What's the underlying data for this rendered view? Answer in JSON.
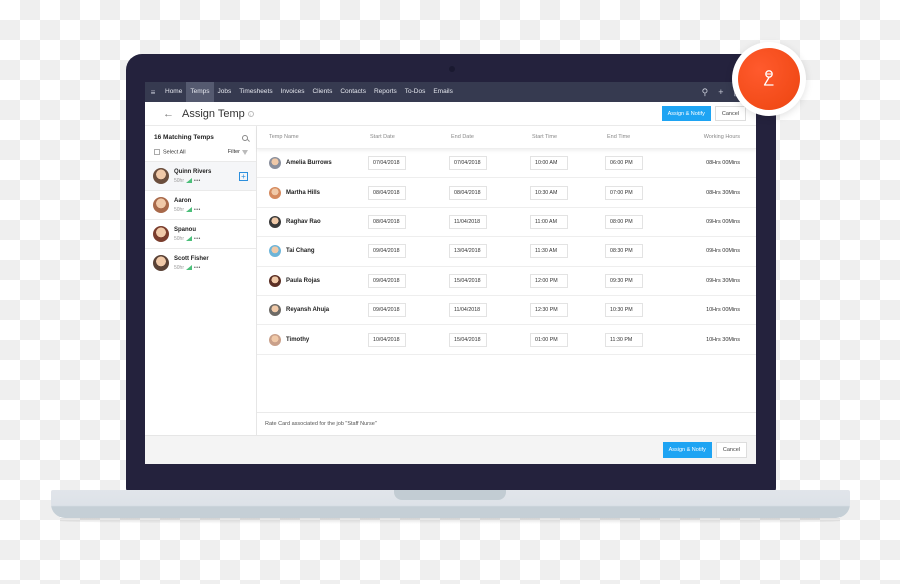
{
  "nav": {
    "items": [
      "Home",
      "Temps",
      "Jobs",
      "Timesheets",
      "Invoices",
      "Clients",
      "Contacts",
      "Reports",
      "To-Dos",
      "Emails"
    ],
    "active": "Temps",
    "icons": [
      "search-icon",
      "plus-icon",
      "calendar-icon"
    ]
  },
  "header": {
    "title": "Assign Temp",
    "assign_label": "Assign & Notify",
    "cancel_label": "Cancel"
  },
  "sidebar": {
    "title": "16 Matching Temps",
    "select_all": "Select All",
    "filter": "Filter",
    "temps": [
      {
        "name": "Quinn Rivers",
        "rate": "50hr",
        "selected": true,
        "avatar_color": "#6b4e3d"
      },
      {
        "name": "Aaron",
        "rate": "50hr",
        "selected": false,
        "avatar_color": "#a8694a"
      },
      {
        "name": "Spanou",
        "rate": "50hr",
        "selected": false,
        "avatar_color": "#7a3d2d"
      },
      {
        "name": "Scott Fisher",
        "rate": "50hr",
        "selected": false,
        "avatar_color": "#5a4236"
      }
    ]
  },
  "table": {
    "headers": {
      "name": "Temp Name",
      "start_date": "Start Date",
      "end_date": "End Date",
      "start_time": "Start Time",
      "end_time": "End Time",
      "working_hours": "Working Hours"
    },
    "rows": [
      {
        "name": "Amelia Burrows",
        "start_date": "07/04/2018",
        "end_date": "07/04/2018",
        "start_time": "10:00 AM",
        "end_time": "06:00 PM",
        "hours": "08Hrs 00Mins",
        "avatar_color": "#8a8f9c"
      },
      {
        "name": "Martha Hills",
        "start_date": "08/04/2018",
        "end_date": "08/04/2018",
        "start_time": "10:30 AM",
        "end_time": "07:00 PM",
        "hours": "08Hrs 30Mins",
        "avatar_color": "#d58a5e"
      },
      {
        "name": "Raghav Rao",
        "start_date": "08/04/2018",
        "end_date": "11/04/2018",
        "start_time": "11:00 AM",
        "end_time": "08:00 PM",
        "hours": "09Hrs 00Mins",
        "avatar_color": "#3a3a3a"
      },
      {
        "name": "Tai Chang",
        "start_date": "09/04/2018",
        "end_date": "13/04/2018",
        "start_time": "11:30 AM",
        "end_time": "08:30 PM",
        "hours": "09Hrs 00Mins",
        "avatar_color": "#6cb4d8"
      },
      {
        "name": "Paula Rojas",
        "start_date": "09/04/2018",
        "end_date": "15/04/2018",
        "start_time": "12:00 PM",
        "end_time": "09:30 PM",
        "hours": "09Hrs 30Mins",
        "avatar_color": "#5b2f24"
      },
      {
        "name": "Reyansh Ahuja",
        "start_date": "09/04/2018",
        "end_date": "11/04/2018",
        "start_time": "12:30 PM",
        "end_time": "10:30 PM",
        "hours": "10Hrs 00Mins",
        "avatar_color": "#6d6a66"
      },
      {
        "name": "Timothy",
        "start_date": "10/04/2018",
        "end_date": "15/04/2018",
        "start_time": "01:00 PM",
        "end_time": "11:30 PM",
        "hours": "10Hrs 30Mins",
        "avatar_color": "#c9a08a"
      }
    ],
    "rate_card": "Rate Card associated for the job \"Staff Nurse\""
  },
  "footer": {
    "assign_label": "Assign & Notify",
    "cancel_label": "Cancel"
  },
  "colors": {
    "accent": "#1ea4f3",
    "nav_bg": "#363a50",
    "laptop_frame": "#24223d",
    "badge": "#f24b18",
    "signal": "#4cbf7a"
  }
}
